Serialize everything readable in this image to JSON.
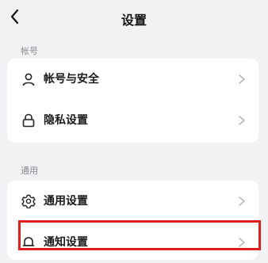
{
  "header": {
    "title": "设置",
    "back_icon": "chevron-left-icon"
  },
  "sections": [
    {
      "label": "帐号",
      "items": [
        {
          "label": "帐号与安全",
          "icon": "user-icon"
        },
        {
          "label": "隐私设置",
          "icon": "lock-icon"
        }
      ]
    },
    {
      "label": "通用",
      "items": [
        {
          "label": "通用设置",
          "icon": "gear-icon"
        },
        {
          "label": "通知设置",
          "icon": "bell-icon"
        }
      ]
    }
  ],
  "colors": {
    "background": "#f2f2f4",
    "card": "#ffffff",
    "highlight": "#e31c1c",
    "chevron": "#b5b5b8"
  }
}
